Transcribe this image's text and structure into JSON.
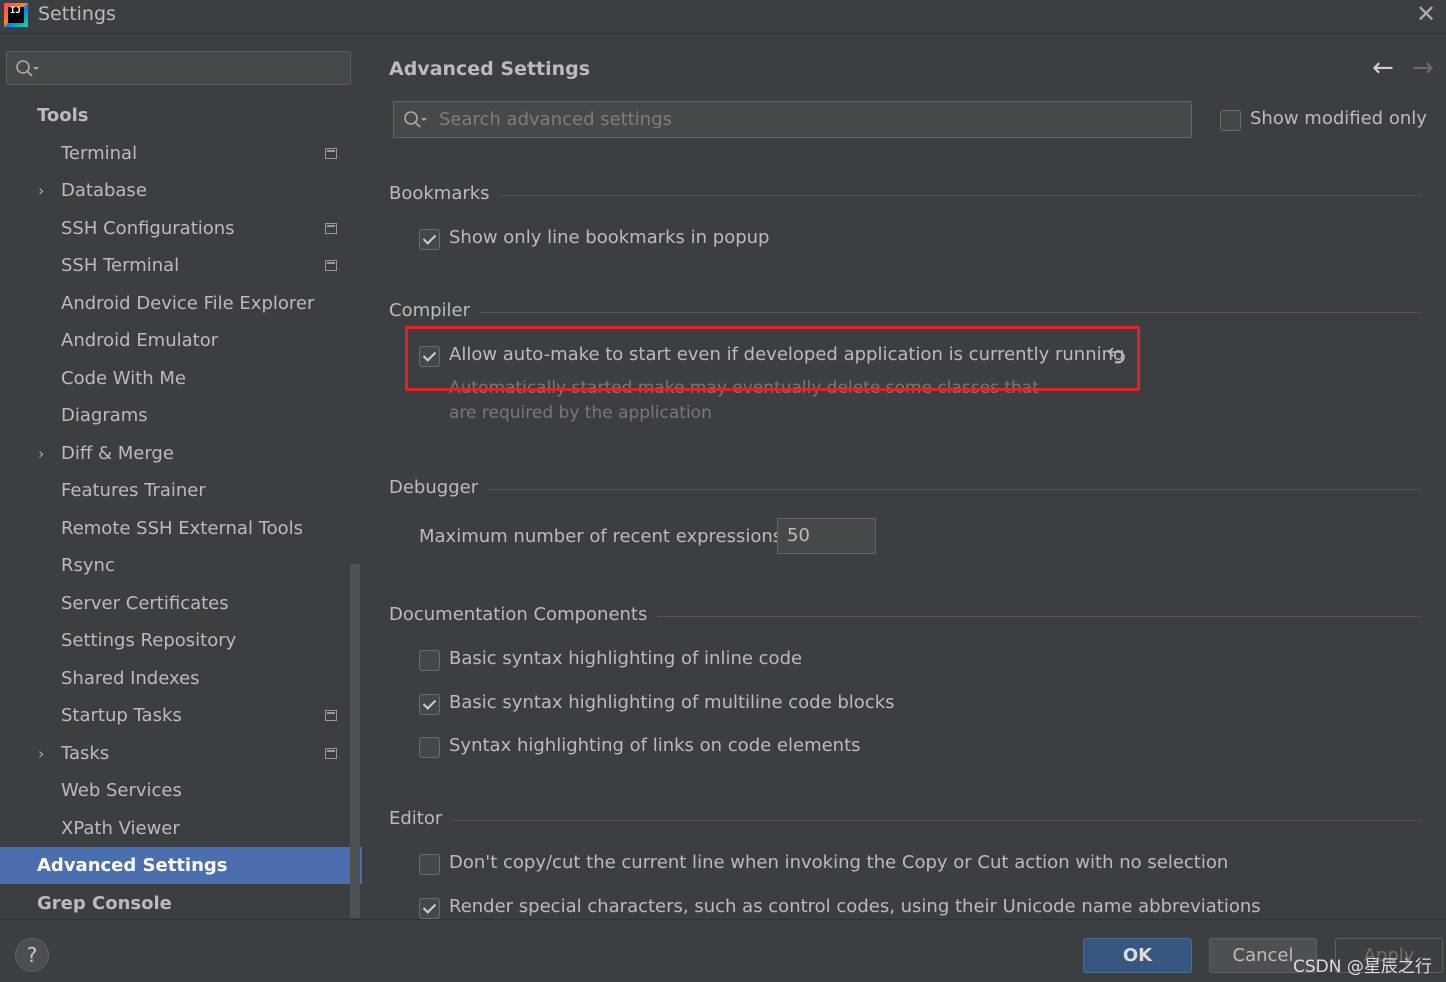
{
  "window": {
    "title": "Settings",
    "app_icon_text": "IJ",
    "close_glyph": "✕"
  },
  "sidebar": {
    "search_value": "",
    "items": [
      {
        "label": "Tools",
        "level": 0
      },
      {
        "label": "Terminal",
        "level": 1,
        "project_icon": true
      },
      {
        "label": "Database",
        "level": 1,
        "expandable": true
      },
      {
        "label": "SSH Configurations",
        "level": 1,
        "project_icon": true
      },
      {
        "label": "SSH Terminal",
        "level": 1,
        "project_icon": true
      },
      {
        "label": "Android Device File Explorer",
        "level": 1
      },
      {
        "label": "Android Emulator",
        "level": 1
      },
      {
        "label": "Code With Me",
        "level": 1
      },
      {
        "label": "Diagrams",
        "level": 1
      },
      {
        "label": "Diff & Merge",
        "level": 1,
        "expandable": true
      },
      {
        "label": "Features Trainer",
        "level": 1
      },
      {
        "label": "Remote SSH External Tools",
        "level": 1
      },
      {
        "label": "Rsync",
        "level": 1
      },
      {
        "label": "Server Certificates",
        "level": 1
      },
      {
        "label": "Settings Repository",
        "level": 1
      },
      {
        "label": "Shared Indexes",
        "level": 1
      },
      {
        "label": "Startup Tasks",
        "level": 1,
        "project_icon": true
      },
      {
        "label": "Tasks",
        "level": 1,
        "expandable": true,
        "project_icon": true
      },
      {
        "label": "Web Services",
        "level": 1
      },
      {
        "label": "XPath Viewer",
        "level": 1
      },
      {
        "label": "Advanced Settings",
        "level": 0,
        "selected": true
      },
      {
        "label": "Grep Console",
        "level": 0
      }
    ]
  },
  "main": {
    "title": "Advanced Settings",
    "back_glyph": "←",
    "forward_glyph": "→",
    "search": {
      "placeholder": "Search advanced settings",
      "value": ""
    },
    "show_modified_only": {
      "label": "Show modified only",
      "checked": false
    },
    "sections": {
      "bookmarks": {
        "title": "Bookmarks",
        "options": [
          {
            "label": "Show only line bookmarks in popup",
            "checked": true
          }
        ]
      },
      "compiler": {
        "title": "Compiler",
        "option": {
          "label": "Allow auto-make to start even if developed application is currently running",
          "checked": true
        },
        "hint_line1": "Automatically started make may eventually delete some classes that",
        "hint_line2": "are required by the application"
      },
      "debugger": {
        "title": "Debugger",
        "field_label": "Maximum number of recent expressions:",
        "field_value": "50"
      },
      "documentation": {
        "title": "Documentation Components",
        "options": [
          {
            "label": "Basic syntax highlighting of inline code",
            "checked": false
          },
          {
            "label": "Basic syntax highlighting of multiline code blocks",
            "checked": true
          },
          {
            "label": "Syntax highlighting of links on code elements",
            "checked": false
          }
        ]
      },
      "editor": {
        "title": "Editor",
        "options": [
          {
            "label": "Don't copy/cut the current line when invoking the Copy or Cut action with no selection",
            "checked": false
          },
          {
            "label": "Render special characters, such as control codes, using their Unicode name abbreviations",
            "checked": true
          }
        ]
      }
    }
  },
  "footer": {
    "help_label": "?",
    "ok_label": "OK",
    "cancel_label": "Cancel",
    "apply_label": "Apply",
    "watermark": "CSDN @星辰之行"
  },
  "colors": {
    "background": "#3c3f41",
    "selection": "#4b6eaf",
    "highlight_border": "#e02424",
    "ok_button": "#365880"
  }
}
